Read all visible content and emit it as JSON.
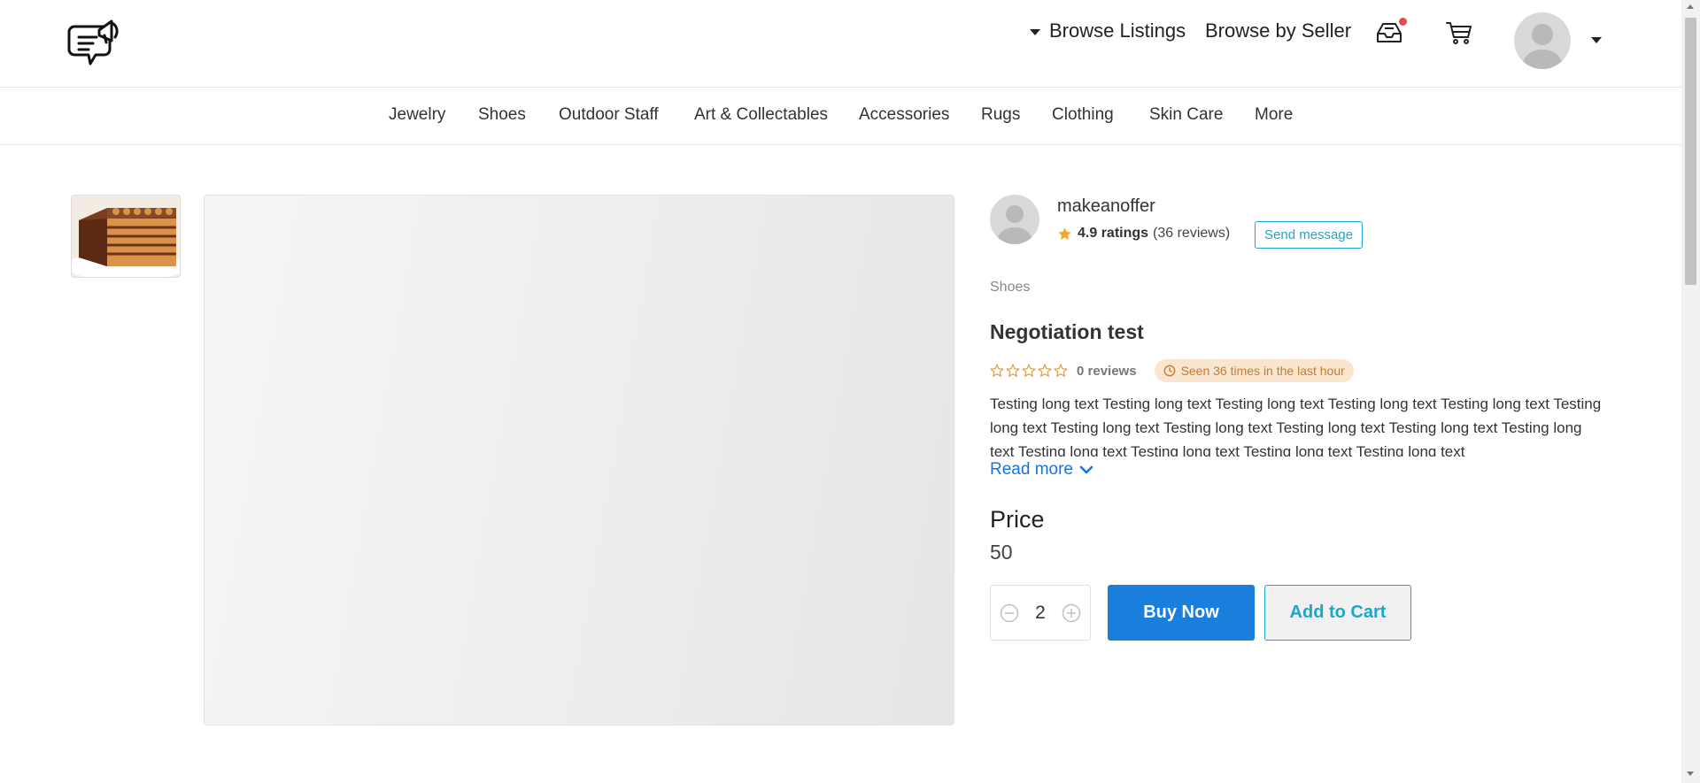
{
  "header": {
    "browse_listings": "Browse Listings",
    "browse_by_seller": "Browse by Seller"
  },
  "categories": [
    "Jewelry",
    "Shoes",
    "Outdoor Staff",
    "Art & Collectables",
    "Accessories",
    "Rugs",
    "Clothing",
    "Skin Care",
    "More"
  ],
  "seller": {
    "name": "makeanoffer",
    "rating": "4.9 ratings",
    "reviews": "(36 reviews)",
    "send_message": "Send message"
  },
  "product": {
    "category": "Shoes",
    "title": "Negotiation test",
    "reviews": "0 reviews",
    "seen": "Seen 36 times in the last hour",
    "description": "Testing long text Testing long text Testing long text Testing long text Testing long text Testing long text Testing long text Testing long text Testing long text Testing long text Testing long text Testing long text Testing long text Testing long text Testing long text",
    "read_more": "Read more",
    "price_label": "Price",
    "price_value": "50",
    "quantity": "2",
    "buy_now": "Buy Now",
    "add_to_cart": "Add to Cart"
  },
  "colors": {
    "accent": "#1a7fdc",
    "secondary": "#1fa5c9",
    "star": "#f5a623",
    "badge_bg": "#fae5cf",
    "badge_text": "#c37c32",
    "notification": "#e24c4c"
  },
  "icons": [
    "logo-chat-megaphone",
    "caret-down-icon",
    "inbox-icon",
    "cart-icon",
    "avatar-icon",
    "star-icon",
    "clock-icon",
    "chevron-down-icon",
    "minus-circle-icon",
    "plus-circle-icon"
  ]
}
